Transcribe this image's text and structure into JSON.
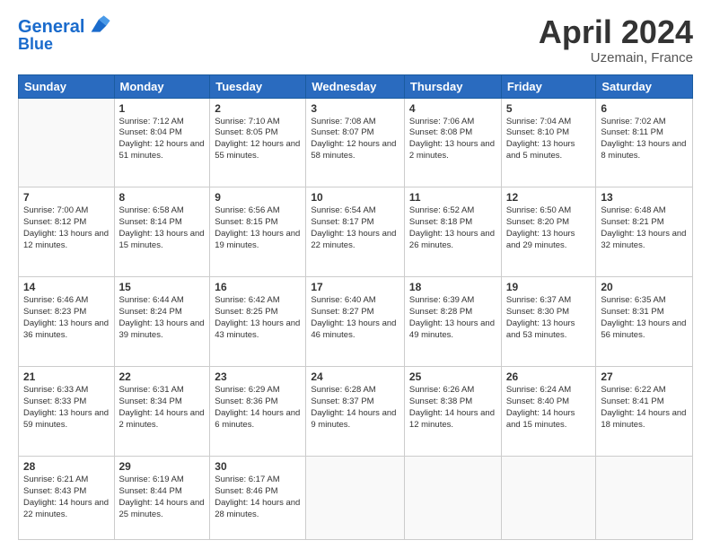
{
  "header": {
    "logo_line1": "General",
    "logo_line2": "Blue",
    "month": "April 2024",
    "location": "Uzemain, France"
  },
  "weekdays": [
    "Sunday",
    "Monday",
    "Tuesday",
    "Wednesday",
    "Thursday",
    "Friday",
    "Saturday"
  ],
  "weeks": [
    [
      {
        "day": "",
        "sunrise": "",
        "sunset": "",
        "daylight": ""
      },
      {
        "day": "1",
        "sunrise": "Sunrise: 7:12 AM",
        "sunset": "Sunset: 8:04 PM",
        "daylight": "Daylight: 12 hours and 51 minutes."
      },
      {
        "day": "2",
        "sunrise": "Sunrise: 7:10 AM",
        "sunset": "Sunset: 8:05 PM",
        "daylight": "Daylight: 12 hours and 55 minutes."
      },
      {
        "day": "3",
        "sunrise": "Sunrise: 7:08 AM",
        "sunset": "Sunset: 8:07 PM",
        "daylight": "Daylight: 12 hours and 58 minutes."
      },
      {
        "day": "4",
        "sunrise": "Sunrise: 7:06 AM",
        "sunset": "Sunset: 8:08 PM",
        "daylight": "Daylight: 13 hours and 2 minutes."
      },
      {
        "day": "5",
        "sunrise": "Sunrise: 7:04 AM",
        "sunset": "Sunset: 8:10 PM",
        "daylight": "Daylight: 13 hours and 5 minutes."
      },
      {
        "day": "6",
        "sunrise": "Sunrise: 7:02 AM",
        "sunset": "Sunset: 8:11 PM",
        "daylight": "Daylight: 13 hours and 8 minutes."
      }
    ],
    [
      {
        "day": "7",
        "sunrise": "Sunrise: 7:00 AM",
        "sunset": "Sunset: 8:12 PM",
        "daylight": "Daylight: 13 hours and 12 minutes."
      },
      {
        "day": "8",
        "sunrise": "Sunrise: 6:58 AM",
        "sunset": "Sunset: 8:14 PM",
        "daylight": "Daylight: 13 hours and 15 minutes."
      },
      {
        "day": "9",
        "sunrise": "Sunrise: 6:56 AM",
        "sunset": "Sunset: 8:15 PM",
        "daylight": "Daylight: 13 hours and 19 minutes."
      },
      {
        "day": "10",
        "sunrise": "Sunrise: 6:54 AM",
        "sunset": "Sunset: 8:17 PM",
        "daylight": "Daylight: 13 hours and 22 minutes."
      },
      {
        "day": "11",
        "sunrise": "Sunrise: 6:52 AM",
        "sunset": "Sunset: 8:18 PM",
        "daylight": "Daylight: 13 hours and 26 minutes."
      },
      {
        "day": "12",
        "sunrise": "Sunrise: 6:50 AM",
        "sunset": "Sunset: 8:20 PM",
        "daylight": "Daylight: 13 hours and 29 minutes."
      },
      {
        "day": "13",
        "sunrise": "Sunrise: 6:48 AM",
        "sunset": "Sunset: 8:21 PM",
        "daylight": "Daylight: 13 hours and 32 minutes."
      }
    ],
    [
      {
        "day": "14",
        "sunrise": "Sunrise: 6:46 AM",
        "sunset": "Sunset: 8:23 PM",
        "daylight": "Daylight: 13 hours and 36 minutes."
      },
      {
        "day": "15",
        "sunrise": "Sunrise: 6:44 AM",
        "sunset": "Sunset: 8:24 PM",
        "daylight": "Daylight: 13 hours and 39 minutes."
      },
      {
        "day": "16",
        "sunrise": "Sunrise: 6:42 AM",
        "sunset": "Sunset: 8:25 PM",
        "daylight": "Daylight: 13 hours and 43 minutes."
      },
      {
        "day": "17",
        "sunrise": "Sunrise: 6:40 AM",
        "sunset": "Sunset: 8:27 PM",
        "daylight": "Daylight: 13 hours and 46 minutes."
      },
      {
        "day": "18",
        "sunrise": "Sunrise: 6:39 AM",
        "sunset": "Sunset: 8:28 PM",
        "daylight": "Daylight: 13 hours and 49 minutes."
      },
      {
        "day": "19",
        "sunrise": "Sunrise: 6:37 AM",
        "sunset": "Sunset: 8:30 PM",
        "daylight": "Daylight: 13 hours and 53 minutes."
      },
      {
        "day": "20",
        "sunrise": "Sunrise: 6:35 AM",
        "sunset": "Sunset: 8:31 PM",
        "daylight": "Daylight: 13 hours and 56 minutes."
      }
    ],
    [
      {
        "day": "21",
        "sunrise": "Sunrise: 6:33 AM",
        "sunset": "Sunset: 8:33 PM",
        "daylight": "Daylight: 13 hours and 59 minutes."
      },
      {
        "day": "22",
        "sunrise": "Sunrise: 6:31 AM",
        "sunset": "Sunset: 8:34 PM",
        "daylight": "Daylight: 14 hours and 2 minutes."
      },
      {
        "day": "23",
        "sunrise": "Sunrise: 6:29 AM",
        "sunset": "Sunset: 8:36 PM",
        "daylight": "Daylight: 14 hours and 6 minutes."
      },
      {
        "day": "24",
        "sunrise": "Sunrise: 6:28 AM",
        "sunset": "Sunset: 8:37 PM",
        "daylight": "Daylight: 14 hours and 9 minutes."
      },
      {
        "day": "25",
        "sunrise": "Sunrise: 6:26 AM",
        "sunset": "Sunset: 8:38 PM",
        "daylight": "Daylight: 14 hours and 12 minutes."
      },
      {
        "day": "26",
        "sunrise": "Sunrise: 6:24 AM",
        "sunset": "Sunset: 8:40 PM",
        "daylight": "Daylight: 14 hours and 15 minutes."
      },
      {
        "day": "27",
        "sunrise": "Sunrise: 6:22 AM",
        "sunset": "Sunset: 8:41 PM",
        "daylight": "Daylight: 14 hours and 18 minutes."
      }
    ],
    [
      {
        "day": "28",
        "sunrise": "Sunrise: 6:21 AM",
        "sunset": "Sunset: 8:43 PM",
        "daylight": "Daylight: 14 hours and 22 minutes."
      },
      {
        "day": "29",
        "sunrise": "Sunrise: 6:19 AM",
        "sunset": "Sunset: 8:44 PM",
        "daylight": "Daylight: 14 hours and 25 minutes."
      },
      {
        "day": "30",
        "sunrise": "Sunrise: 6:17 AM",
        "sunset": "Sunset: 8:46 PM",
        "daylight": "Daylight: 14 hours and 28 minutes."
      },
      {
        "day": "",
        "sunrise": "",
        "sunset": "",
        "daylight": ""
      },
      {
        "day": "",
        "sunrise": "",
        "sunset": "",
        "daylight": ""
      },
      {
        "day": "",
        "sunrise": "",
        "sunset": "",
        "daylight": ""
      },
      {
        "day": "",
        "sunrise": "",
        "sunset": "",
        "daylight": ""
      }
    ]
  ]
}
